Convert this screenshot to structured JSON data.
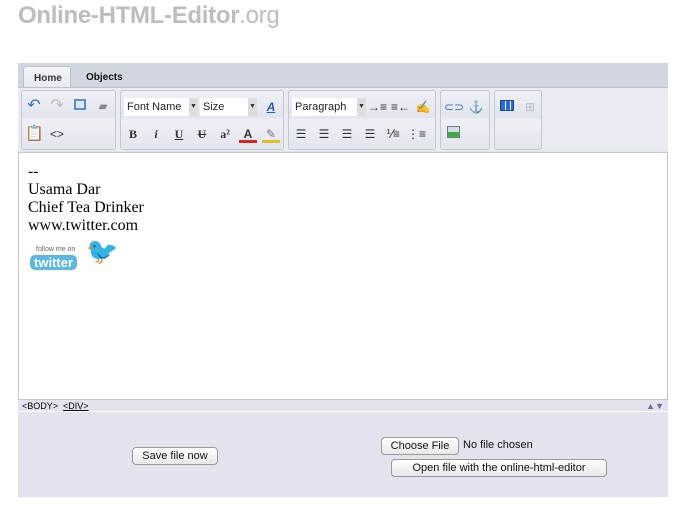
{
  "logo": {
    "main": "Online-HTML-Editor",
    "suffix": ".org"
  },
  "tabs": [
    {
      "label": "Home"
    },
    {
      "label": "Objects"
    }
  ],
  "toolbar": {
    "font_name": "Font Name",
    "size": "Size",
    "paragraph": "Paragraph",
    "bold": "B",
    "italic": "i",
    "underline": "U",
    "strike": "U",
    "superscript": "a²",
    "font_color": "A",
    "source": "<>"
  },
  "content": {
    "lines": [
      "--",
      "Usama Dar",
      "Chief Tea Drinker",
      "www.twitter.com"
    ],
    "badge_small": "follow me on",
    "badge_big": "twitter"
  },
  "status": {
    "body": "<BODY>",
    "div": "<DIV>"
  },
  "actions": {
    "save": "Save file now",
    "choose": "Choose File",
    "no_file": "No file chosen",
    "open": "Open file with the online-html-editor"
  }
}
